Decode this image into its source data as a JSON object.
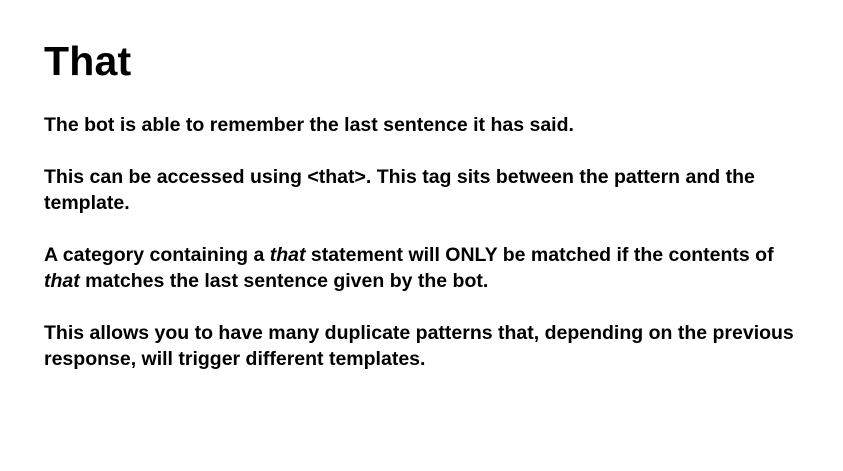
{
  "slide": {
    "title": "That",
    "p1": "The bot is able to remember the last sentence it has said.",
    "p2": "This can be accessed using <that>. This tag sits between the pattern and the template.",
    "p3": {
      "a": "A category containing a ",
      "that1": "that",
      "b": " statement will ONLY be matched if the contents of ",
      "that2": "that",
      "c": " matches the last sentence given by the bot."
    },
    "p4": "This allows you to have many duplicate patterns that, depending on the previous response, will trigger different templates."
  }
}
